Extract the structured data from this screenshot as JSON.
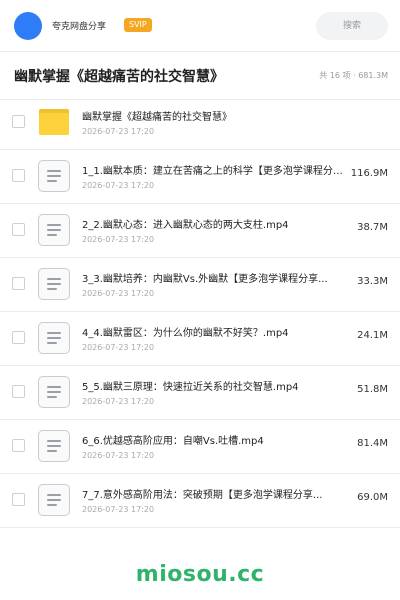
{
  "header": {
    "site_name": "夸克网盘分享",
    "badge": "SVIP",
    "search_placeholder": "搜索"
  },
  "title_bar": {
    "title": "幽默掌握《超越痛苦的社交智慧》",
    "summary": "共 16 项 · 681.3M"
  },
  "files": [
    {
      "name": "幽默掌握《超越痛苦的社交智慧》",
      "date": "2026-07-23 17:20",
      "size": "",
      "icon": "folder-icon"
    },
    {
      "name": "1_1.幽默本质：建立在苦痛之上的科学【更多泡学课程分享...",
      "date": "2026-07-23 17:20",
      "size": "116.9M",
      "icon": "document-icon"
    },
    {
      "name": "2_2.幽默心态：进入幽默心态的两大支柱.mp4",
      "date": "2026-07-23 17:20",
      "size": "38.7M",
      "icon": "document-icon"
    },
    {
      "name": "3_3.幽默培养：内幽默Vs.外幽默【更多泡学课程分享...",
      "date": "2026-07-23 17:20",
      "size": "33.3M",
      "icon": "document-icon"
    },
    {
      "name": "4_4.幽默雷区：为什么你的幽默不好笑？.mp4",
      "date": "2026-07-23 17:20",
      "size": "24.1M",
      "icon": "document-icon"
    },
    {
      "name": "5_5.幽默三原理：快速拉近关系的社交智慧.mp4",
      "date": "2026-07-23 17:20",
      "size": "51.8M",
      "icon": "document-icon"
    },
    {
      "name": "6_6.优越感高阶应用：自嘲Vs.吐槽.mp4",
      "date": "2026-07-23 17:20",
      "size": "81.4M",
      "icon": "document-icon"
    },
    {
      "name": "7_7.意外感高阶用法：突破预期【更多泡学课程分享...",
      "date": "2026-07-23 17:20",
      "size": "69.0M",
      "icon": "document-icon"
    }
  ],
  "watermark": "miosou.cc",
  "colors": {
    "accent": "#2f7df6",
    "badge": "#f5a623",
    "folder": "#fbd23a",
    "watermark": "#2fb36b"
  }
}
